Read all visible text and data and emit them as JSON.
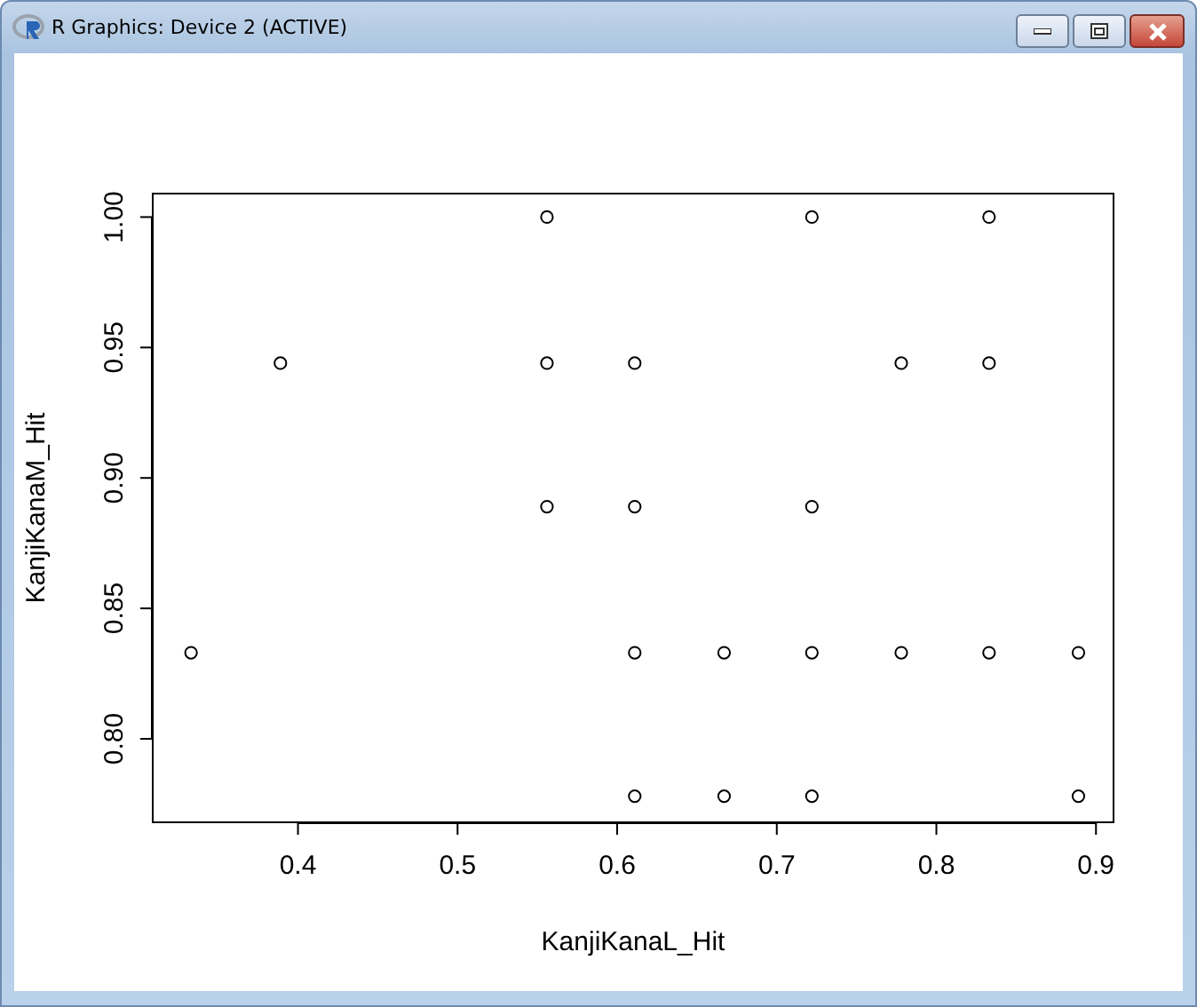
{
  "window": {
    "title": "R Graphics: Device 2 (ACTIVE)"
  },
  "plot": {
    "chart_data": {
      "type": "scatter",
      "xlabel": "KanjiKanaL_Hit",
      "ylabel": "KanjiKanaM_Hit",
      "x": [
        0.333,
        0.389,
        0.556,
        0.556,
        0.556,
        0.611,
        0.611,
        0.611,
        0.611,
        0.667,
        0.667,
        0.722,
        0.722,
        0.722,
        0.722,
        0.778,
        0.778,
        0.833,
        0.833,
        0.833,
        0.889,
        0.889
      ],
      "series": [
        {
          "color": "#000000",
          "values": [
            0.833,
            0.944,
            1.0,
            0.944,
            0.889,
            0.944,
            0.889,
            0.833,
            0.778,
            0.833,
            0.778,
            1.0,
            0.889,
            0.833,
            0.778,
            0.944,
            0.833,
            1.0,
            0.944,
            0.833,
            0.833,
            0.778
          ]
        }
      ],
      "xlim": [
        0.309,
        0.911
      ],
      "ylim": [
        0.768,
        1.009
      ],
      "xticks": [
        {
          "value": 0.4,
          "label": "0.4"
        },
        {
          "value": 0.5,
          "label": "0.5"
        },
        {
          "value": 0.6,
          "label": "0.6"
        },
        {
          "value": 0.7,
          "label": "0.7"
        },
        {
          "value": 0.8,
          "label": "0.8"
        },
        {
          "value": 0.9,
          "label": "0.9"
        }
      ],
      "yticks": [
        {
          "value": 0.8,
          "label": "0.80"
        },
        {
          "value": 0.85,
          "label": "0.85"
        },
        {
          "value": 0.9,
          "label": "0.90"
        },
        {
          "value": 0.95,
          "label": "0.95"
        },
        {
          "value": 1.0,
          "label": "1.00"
        }
      ]
    }
  }
}
